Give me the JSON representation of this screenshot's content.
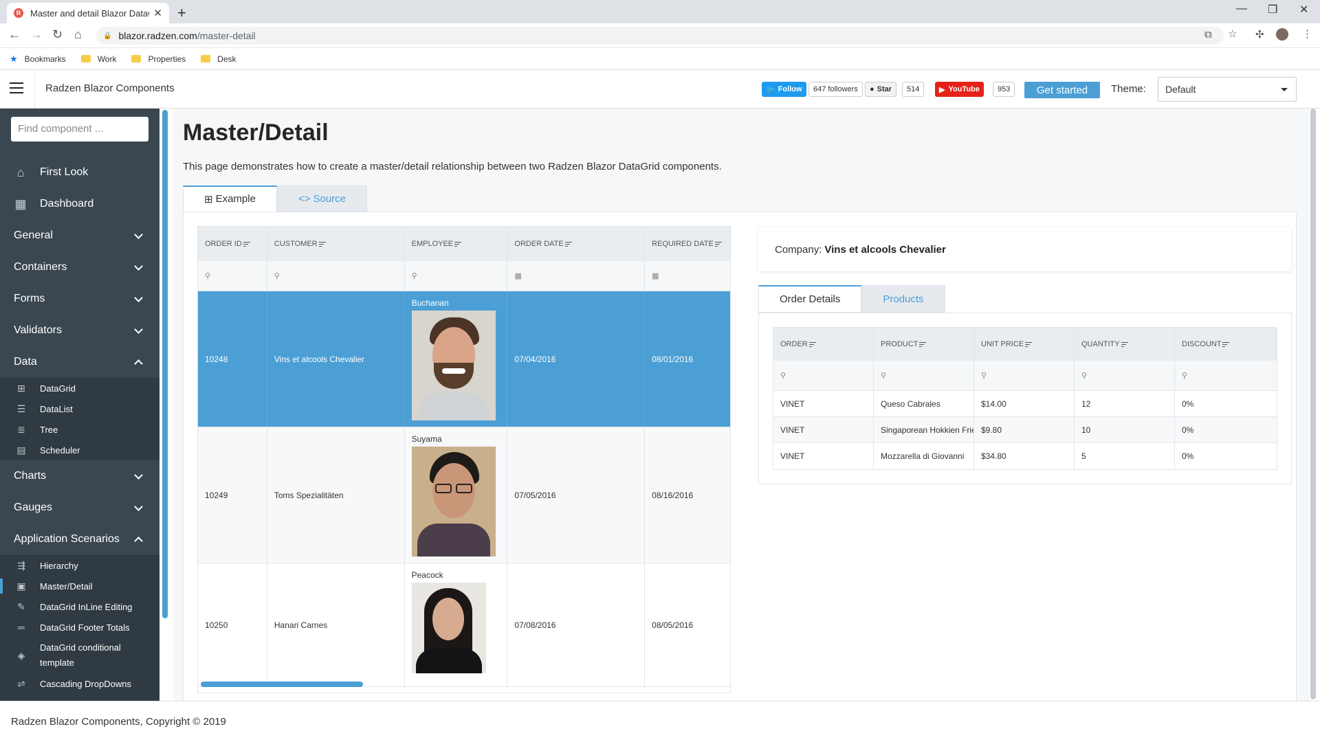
{
  "browser": {
    "tab_title": "Master and detail Blazor DataGrid",
    "url_host": "blazor.radzen.com",
    "url_path": "/master-detail",
    "bookmarks": [
      "Bookmarks",
      "Work",
      "Properties",
      "Desk"
    ]
  },
  "header": {
    "app_title": "Radzen Blazor Components",
    "twitter_follow": "Follow",
    "twitter_followers": "647 followers",
    "github_star": "Star",
    "github_count": "514",
    "youtube": "YouTube",
    "youtube_count": "953",
    "get_started": "Get started",
    "theme_label": "Theme:",
    "theme_value": "Default"
  },
  "sidebar": {
    "search_placeholder": "Find component ...",
    "items": {
      "first_look": "First Look",
      "dashboard": "Dashboard",
      "general": "General",
      "containers": "Containers",
      "forms": "Forms",
      "validators": "Validators",
      "data": "Data",
      "charts": "Charts",
      "gauges": "Gauges",
      "app_scenarios": "Application Scenarios"
    },
    "data_sub": [
      "DataGrid",
      "DataList",
      "Tree",
      "Scheduler"
    ],
    "scenario_sub": [
      "Hierarchy",
      "Master/Detail",
      "DataGrid InLine Editing",
      "DataGrid Footer Totals",
      "DataGrid conditional template",
      "Cascading DropDowns"
    ]
  },
  "main": {
    "title": "Master/Detail",
    "description": "This page demonstrates how to create a master/detail relationship between two Radzen Blazor DataGrid components.",
    "tabs": [
      "Example",
      "Source"
    ]
  },
  "master_grid": {
    "columns": [
      "Order ID",
      "Customer",
      "Employee",
      "Order Date",
      "Required Date"
    ],
    "rows": [
      {
        "order_id": "10248",
        "customer": "Vins et alcools Chevalier",
        "employee": "Buchanan",
        "order_date": "07/04/2016",
        "required_date": "08/01/2016"
      },
      {
        "order_id": "10249",
        "customer": "Toms Spezialitäten",
        "employee": "Suyama",
        "order_date": "07/05/2016",
        "required_date": "08/16/2016"
      },
      {
        "order_id": "10250",
        "customer": "Hanari Carnes",
        "employee": "Peacock",
        "order_date": "07/08/2016",
        "required_date": "08/05/2016"
      }
    ]
  },
  "detail": {
    "company_label": "Company:",
    "company_name": "Vins et alcools Chevalier",
    "tabs": [
      "Order Details",
      "Products"
    ],
    "columns": [
      "Order",
      "Product",
      "Unit Price",
      "Quantity",
      "Discount"
    ],
    "rows": [
      {
        "order": "VINET",
        "product": "Queso Cabrales",
        "unit_price": "$14.00",
        "quantity": "12",
        "discount": "0%"
      },
      {
        "order": "VINET",
        "product": "Singaporean Hokkien Fried Mee",
        "unit_price": "$9.80",
        "quantity": "10",
        "discount": "0%"
      },
      {
        "order": "VINET",
        "product": "Mozzarella di Giovanni",
        "unit_price": "$34.80",
        "quantity": "5",
        "discount": "0%"
      }
    ]
  },
  "footer": {
    "copyright": "Radzen Blazor Components, Copyright © 2019"
  },
  "colors": {
    "accent": "#4b9fd5",
    "sidebar_bg": "#3a4750"
  }
}
